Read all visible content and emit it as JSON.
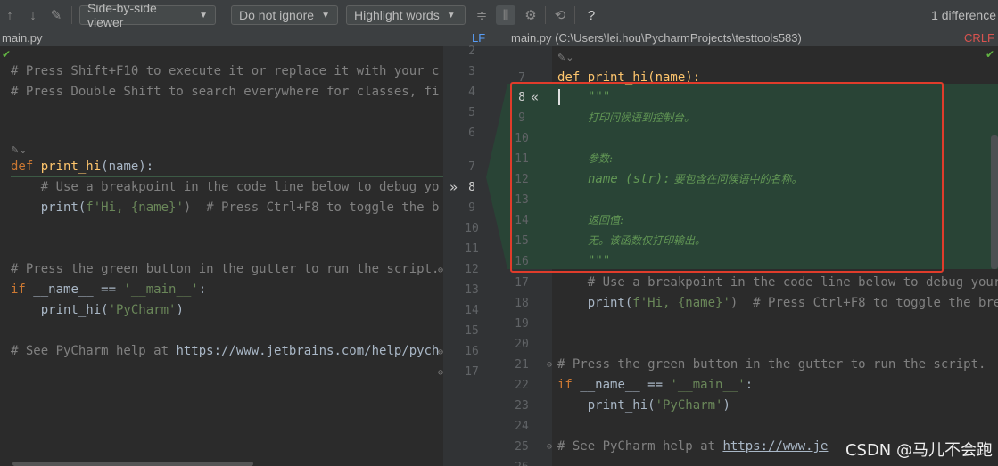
{
  "toolbar": {
    "viewer_label": "Side-by-side viewer",
    "ignore_label": "Do not ignore",
    "highlight_label": "Highlight words",
    "diff_count": "1 difference",
    "help": "?"
  },
  "left_file": {
    "name": "main.py",
    "line_ending": "LF"
  },
  "right_file": {
    "name": "main.py (C:\\Users\\lei.hou\\PycharmProjects\\testtools583)",
    "line_ending": "CRLF"
  },
  "left_lines": {
    "l1": "# Press Shift+F10 to execute it or replace it with your c",
    "l2": "# Press Double Shift to search everywhere for classes, fi",
    "def_kw": "def ",
    "def_name": "print_hi",
    "def_args": "(name):",
    "l_cmt": "    # Use a breakpoint in the code line below to debug yo",
    "print_fn": "    print(",
    "print_str": "f'Hi, {name}'",
    "print_rest": ")  # Press Ctrl+F8 to toggle the b",
    "l_green": "# Press the green button in the gutter to run the script.",
    "if_kw": "if ",
    "if_rest": "__name__ == ",
    "if_str": "'__main__'",
    "if_colon": ":",
    "call": "    print_hi(",
    "call_str": "'PyCharm'",
    "call_end": ")",
    "help_prefix": "# See PyCharm help at ",
    "help_link": "https://www.jetbrains.com/help/pych"
  },
  "mid_numbers": {
    "left": [
      "2",
      "3",
      "4",
      "5",
      "6",
      "7",
      "8",
      "9",
      "10",
      "11",
      "12",
      "13",
      "14",
      "15",
      "16",
      "17"
    ],
    "right_top": "2"
  },
  "right_lines": {
    "top_def": "def print_hi(name):",
    "doc_open": "\"\"\"",
    "doc1": "打印问候语到控制台。",
    "doc_param_h": "参数:",
    "doc_param_name": "name (str):",
    "doc_param_desc": " 要包含在问候语中的名称。",
    "doc_ret_h": "返回值:",
    "doc_ret": "无。该函数仅打印输出。",
    "doc_close": "\"\"\"",
    "r_cmt": "    # Use a breakpoint in the code line below to debug your",
    "r_print": "    print(",
    "r_print_str": "f'Hi, {name}'",
    "r_print_rest": ")  # Press Ctrl+F8 to toggle the bre",
    "r_green": "# Press the green button in the gutter to run the script.",
    "r_if": "if ",
    "r_if_rest": "__name__ == ",
    "r_if_str": "'__main__'",
    "r_if_colon": ":",
    "r_call": "    print_hi(",
    "r_call_str": "'PyCharm'",
    "r_call_end": ")",
    "r_help": "# See PyCharm help at ",
    "r_help_link": "https://www.je"
  },
  "right_numbers": [
    "7",
    "8",
    "9",
    "10",
    "11",
    "12",
    "13",
    "14",
    "15",
    "16",
    "17",
    "18",
    "19",
    "20",
    "21",
    "22",
    "23",
    "24",
    "25",
    "26"
  ],
  "watermark": "CSDN @马儿不会跑",
  "colors": {
    "added_bg": "#294436",
    "highlight_border": "#e03c2b",
    "keyword": "#cc7832",
    "string": "#6a8759",
    "function": "#ffc66d"
  }
}
